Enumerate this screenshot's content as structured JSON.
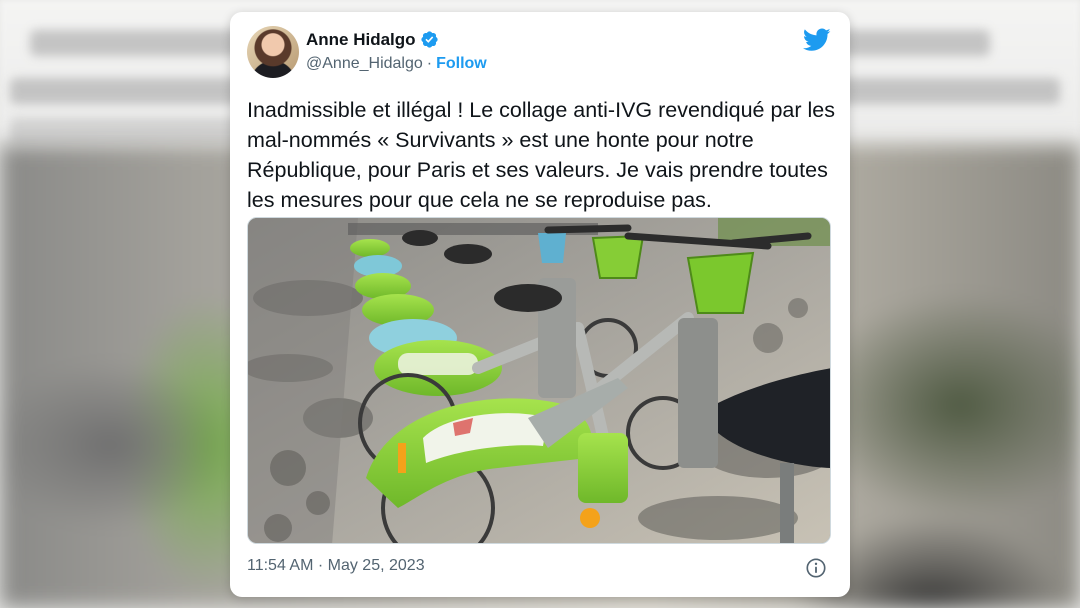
{
  "tweet": {
    "author_name": "Anne Hidalgo",
    "handle": "@Anne_Hidalgo",
    "separator": "·",
    "follow_label": "Follow",
    "text": "Inadmissible et illégal ! Le collage anti-IVG revendiqué par les mal-nommés « Survivants » est une honte pour notre République, pour Paris et ses valeurs. Je vais prendre toutes les mesures pour que cela ne se reproduise pas.",
    "timestamp": "11:54 AM · May 25, 2023"
  },
  "colors": {
    "accent": "#1d9bf0",
    "text": "#0f1419",
    "muted": "#536471",
    "bike_green": "#8cd33a"
  },
  "icons": {
    "verified": "verified-badge-icon",
    "brand": "twitter-bird-icon",
    "info": "info-icon"
  }
}
